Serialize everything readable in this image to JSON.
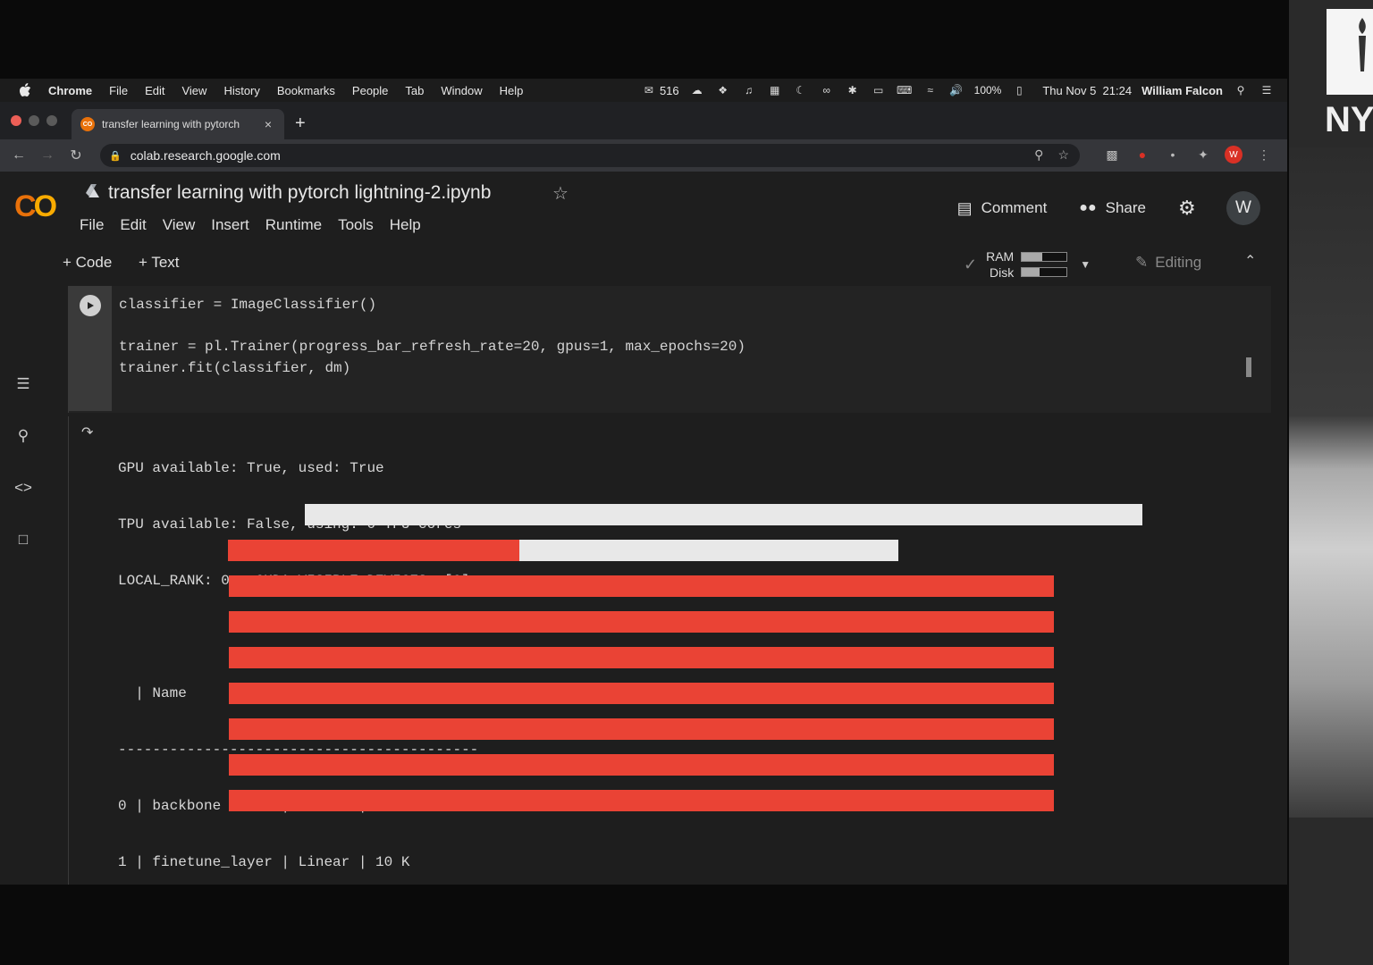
{
  "menubar": {
    "app": "Chrome",
    "items": [
      "File",
      "Edit",
      "View",
      "History",
      "Bookmarks",
      "People",
      "Tab",
      "Window",
      "Help"
    ],
    "mail_count": "516",
    "battery": "100%",
    "datetime": "Thu Nov 5  21:24",
    "user": "William Falcon"
  },
  "browser": {
    "tab_title": "transfer learning with pytorch",
    "tab_favicon": "CO",
    "url": "colab.research.google.com",
    "profile_initial": "W"
  },
  "colab": {
    "notebook_title": "transfer learning with pytorch lightning-2.ipynb",
    "menu": [
      "File",
      "Edit",
      "View",
      "Insert",
      "Runtime",
      "Tools",
      "Help"
    ],
    "comment_label": "Comment",
    "share_label": "Share",
    "avatar_initial": "W",
    "add_code_label": "+ Code",
    "add_text_label": "+ Text",
    "ram_label": "RAM",
    "disk_label": "Disk",
    "ram_usage": 0.45,
    "disk_usage": 0.4,
    "editing_label": "Editing"
  },
  "cell": {
    "line1": "classifier = ImageClassifier()",
    "line2": "",
    "line3": "trainer = pl.Trainer(progress_bar_refresh_rate=20, gpus=1, max_epochs=20)",
    "line4": "trainer.fit(classifier, dm)"
  },
  "output": {
    "lines": [
      "GPU available: True, used: True",
      "TPU available: False, using: 0 TPU cores",
      "LOCAL_RANK: 0 - CUDA_VISIBLE_DEVICES: [0]",
      "",
      "  | Name           | Type   | Params",
      "------------------------------------------",
      "0 | backbone       | ResNet | 25 M  ",
      "1 | finetune_layer | Linear | 10 K  "
    ],
    "progress_bars": [
      {
        "progress": 0.0
      },
      {
        "progress": 0.435
      },
      {
        "progress": 1.0
      },
      {
        "progress": 1.0
      },
      {
        "progress": 1.0
      },
      {
        "progress": 1.0
      },
      {
        "progress": 1.0
      },
      {
        "progress": 1.0
      },
      {
        "progress": 1.0
      }
    ]
  },
  "side_panel": {
    "logo_text": "NY"
  },
  "colors": {
    "accent_red": "#ea4335",
    "bar_bg": "#e8e8e8",
    "colab_orange": "#f9ab00"
  }
}
